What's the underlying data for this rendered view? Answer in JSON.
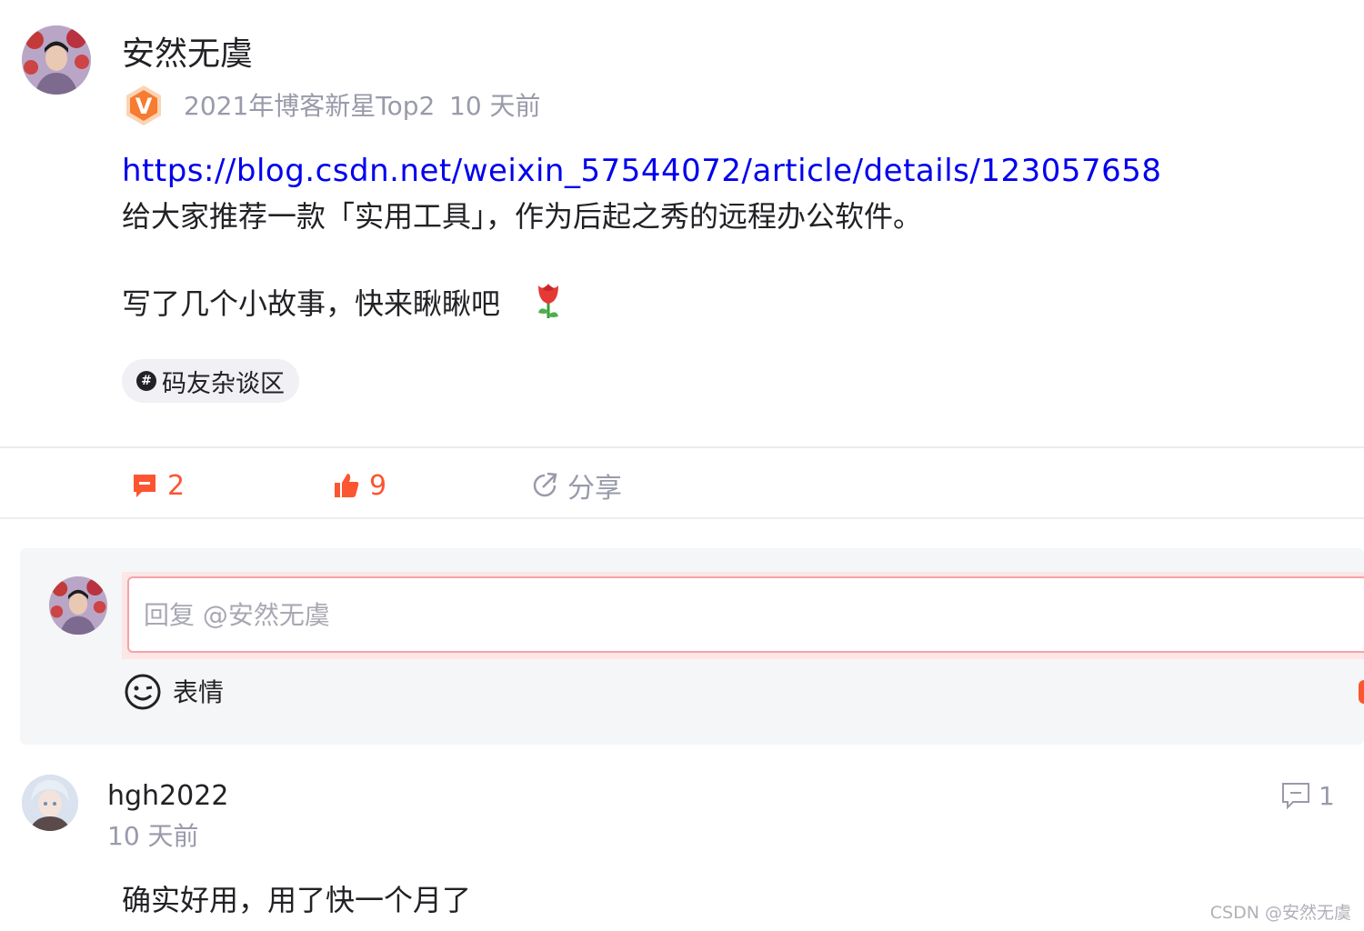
{
  "post": {
    "author": "安然无虞",
    "author_title": "2021年博客新星Top2",
    "time": "10 天前",
    "link": "https://blog.csdn.net/weixin_57544072/article/details/123057658",
    "line1": "给大家推荐一款「实用工具」，作为后起之秀的远程办公软件。",
    "line2": "写了几个小故事，快来瞅瞅吧",
    "topic": "码友杂谈区",
    "topic_icon": "#"
  },
  "actions": {
    "comments": "2",
    "likes": "9",
    "share": "分享"
  },
  "reply_box": {
    "placeholder": "回复 @安然无虞",
    "emoji_label": "表情"
  },
  "comment": {
    "user": "hgh2022",
    "time": "10 天前",
    "reply_count": "1",
    "text": "确实好用，用了快一个月了"
  },
  "watermark": "CSDN @安然无虞",
  "colors": {
    "accent": "#fc5531",
    "link": "#0000ee",
    "muted": "#999aaa"
  }
}
